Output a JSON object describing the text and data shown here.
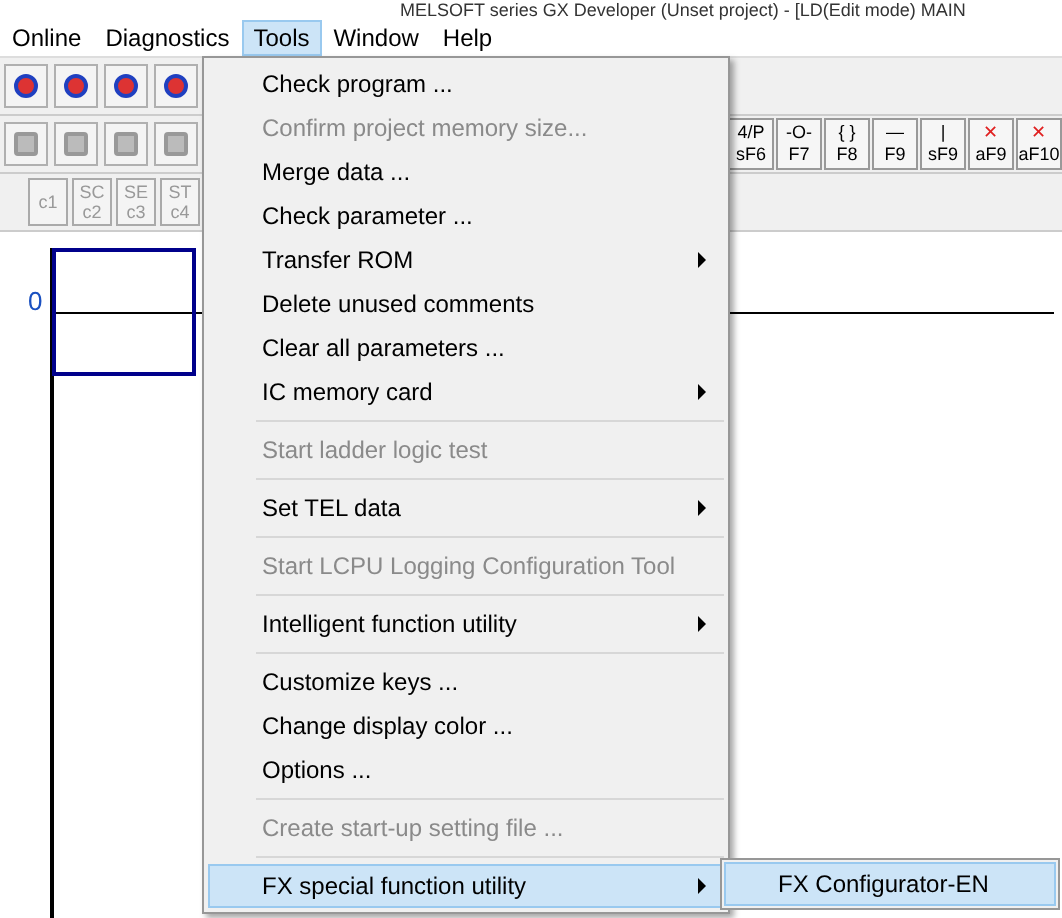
{
  "window": {
    "title": "MELSOFT series GX Developer (Unset project) - [LD(Edit mode)   MAIN"
  },
  "menu_bar": [
    {
      "label": "Online",
      "selected": false
    },
    {
      "label": "Diagnostics",
      "selected": false
    },
    {
      "label": "Tools",
      "selected": true
    },
    {
      "label": "Window",
      "selected": false
    },
    {
      "label": "Help",
      "selected": false
    }
  ],
  "function_keys": [
    {
      "symbol": "4/P",
      "key": "sF6"
    },
    {
      "symbol": "-O-",
      "key": "F7"
    },
    {
      "symbol": "{ }",
      "key": "F8"
    },
    {
      "symbol": "—",
      "key": "F9"
    },
    {
      "symbol": "|",
      "key": "sF9"
    },
    {
      "symbol": "✕",
      "key": "aF9"
    },
    {
      "symbol": "✕",
      "key": "aF10"
    }
  ],
  "comment_keys": [
    {
      "key": "c1"
    },
    {
      "symbol": "SC",
      "key": "c2"
    },
    {
      "symbol": "SE",
      "key": "c3"
    },
    {
      "symbol": "ST",
      "key": "c4"
    }
  ],
  "ladder": {
    "step": "0"
  },
  "tools_menu": [
    {
      "kind": "item",
      "label": "Check program ...",
      "disabled": false,
      "submenu": false,
      "selected": false
    },
    {
      "kind": "item",
      "label": "Confirm project memory size...",
      "disabled": true,
      "submenu": false,
      "selected": false
    },
    {
      "kind": "item",
      "label": "Merge data ...",
      "disabled": false,
      "submenu": false,
      "selected": false
    },
    {
      "kind": "item",
      "label": "Check parameter ...",
      "disabled": false,
      "submenu": false,
      "selected": false
    },
    {
      "kind": "item",
      "label": "Transfer ROM",
      "disabled": false,
      "submenu": true,
      "selected": false
    },
    {
      "kind": "item",
      "label": "Delete unused comments",
      "disabled": false,
      "submenu": false,
      "selected": false
    },
    {
      "kind": "item",
      "label": "Clear all parameters ...",
      "disabled": false,
      "submenu": false,
      "selected": false
    },
    {
      "kind": "item",
      "label": "IC memory card",
      "disabled": false,
      "submenu": true,
      "selected": false
    },
    {
      "kind": "separator"
    },
    {
      "kind": "item",
      "label": "Start ladder logic test",
      "disabled": true,
      "submenu": false,
      "selected": false
    },
    {
      "kind": "separator"
    },
    {
      "kind": "item",
      "label": "Set TEL data",
      "disabled": false,
      "submenu": true,
      "selected": false
    },
    {
      "kind": "separator"
    },
    {
      "kind": "item",
      "label": "Start LCPU Logging Configuration Tool",
      "disabled": true,
      "submenu": false,
      "selected": false
    },
    {
      "kind": "separator"
    },
    {
      "kind": "item",
      "label": "Intelligent function utility",
      "disabled": false,
      "submenu": true,
      "selected": false
    },
    {
      "kind": "separator"
    },
    {
      "kind": "item",
      "label": "Customize keys ...",
      "disabled": false,
      "submenu": false,
      "selected": false
    },
    {
      "kind": "item",
      "label": "Change display color ...",
      "disabled": false,
      "submenu": false,
      "selected": false
    },
    {
      "kind": "item",
      "label": "Options ...",
      "disabled": false,
      "submenu": false,
      "selected": false
    },
    {
      "kind": "separator"
    },
    {
      "kind": "item",
      "label": "Create start-up setting file ...",
      "disabled": true,
      "submenu": false,
      "selected": false
    },
    {
      "kind": "separator"
    },
    {
      "kind": "item",
      "label": "FX special function utility",
      "disabled": false,
      "submenu": true,
      "selected": true
    }
  ],
  "submenu": [
    {
      "label": "FX Configurator-EN",
      "selected": true
    }
  ]
}
